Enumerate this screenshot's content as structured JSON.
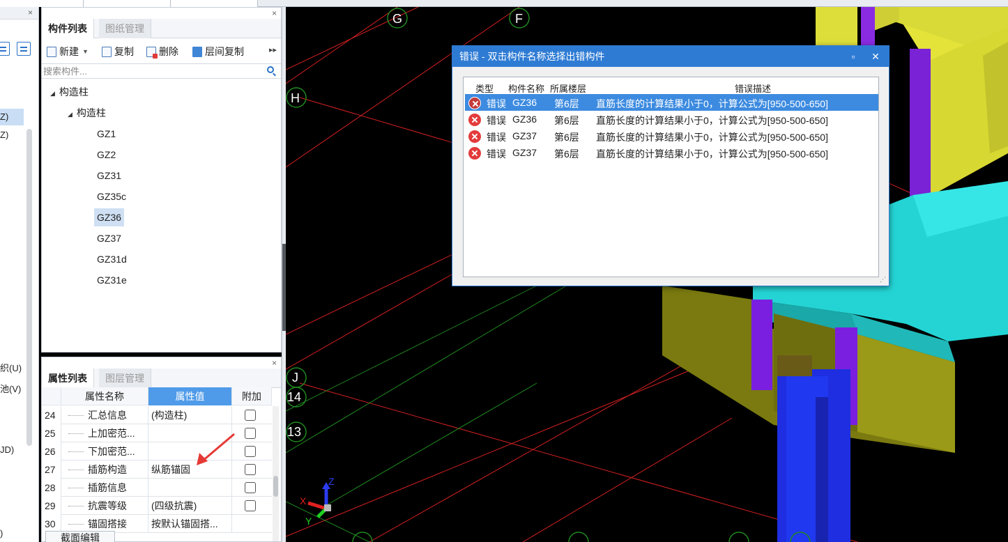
{
  "left_panel": {
    "items": [
      "Z)",
      "Z)",
      "织(U)",
      "池(V)",
      "JD)",
      ")"
    ]
  },
  "component_panel": {
    "tabs": [
      "构件列表",
      "图纸管理"
    ],
    "toolbar": {
      "new": "新建",
      "copy": "复制",
      "delete": "删除",
      "floor_copy": "层间复制"
    },
    "search_placeholder": "搜索构件...",
    "tree": {
      "root": "构造柱",
      "child": "构造柱",
      "items": [
        "GZ1",
        "GZ2",
        "GZ31",
        "GZ35c",
        "GZ36",
        "GZ37",
        "GZ31d",
        "GZ31e"
      ],
      "selected": "GZ36"
    }
  },
  "property_panel": {
    "tabs": [
      "属性列表",
      "图层管理"
    ],
    "headers": {
      "name": "属性名称",
      "value": "属性值",
      "extra": "附加"
    },
    "rows": [
      {
        "no": "24",
        "name": "汇总信息",
        "value": "(构造柱)",
        "checkbox": true
      },
      {
        "no": "25",
        "name": "上加密范...",
        "value": "",
        "checkbox": true
      },
      {
        "no": "26",
        "name": "下加密范...",
        "value": "",
        "checkbox": true
      },
      {
        "no": "27",
        "name": "插筋构造",
        "value": "纵筋锚固",
        "checkbox": true
      },
      {
        "no": "28",
        "name": "插筋信息",
        "value": "",
        "checkbox": true
      },
      {
        "no": "29",
        "name": "抗震等级",
        "value": "(四级抗震)",
        "checkbox": true
      },
      {
        "no": "30",
        "name": "锚固搭接",
        "value": "按默认锚固搭...",
        "checkbox": false
      }
    ],
    "bottom_tab": "截面编辑"
  },
  "viewport": {
    "grid_labels": [
      "G",
      "F",
      "H",
      "J",
      "14",
      "13"
    ],
    "axis_labels": {
      "x": "X",
      "y": "Y",
      "z": "Z"
    }
  },
  "dialog": {
    "title": "错误 - 双击构件名称选择出错构件",
    "columns": {
      "type": "类型",
      "name": "构件名称",
      "floor": "所属楼层",
      "desc": "错误描述"
    },
    "rows": [
      {
        "type": "错误",
        "name": "GZ36",
        "floor": "第6层",
        "desc": "直筋长度的计算结果小于0，计算公式为[950-500-650]"
      },
      {
        "type": "错误",
        "name": "GZ36",
        "floor": "第6层",
        "desc": "直筋长度的计算结果小于0，计算公式为[950-500-650]"
      },
      {
        "type": "错误",
        "name": "GZ37",
        "floor": "第6层",
        "desc": "直筋长度的计算结果小于0，计算公式为[950-500-650]"
      },
      {
        "type": "错误",
        "name": "GZ37",
        "floor": "第6层",
        "desc": "直筋长度的计算结果小于0，计算公式为[950-500-650]"
      }
    ],
    "selected_row": 0
  }
}
